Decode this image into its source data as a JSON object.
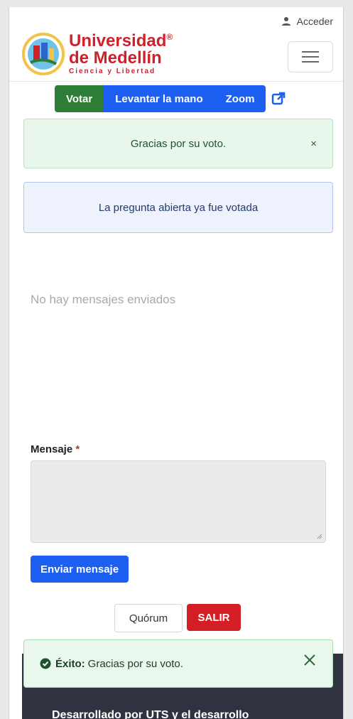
{
  "header": {
    "login_label": "Acceder",
    "logo": {
      "line1": "Universidad",
      "registered": "®",
      "line2": "de Medellín",
      "tagline": "Ciencia y Libertad"
    }
  },
  "actions": {
    "vote_label": "Votar",
    "raise_hand_label": "Levantar la mano",
    "zoom_label": "Zoom"
  },
  "alerts": {
    "success_text": "Gracias por su voto.",
    "success_close": "×",
    "info_text": "La pregunta abierta ya fue votada"
  },
  "messages": {
    "empty_text": "No hay mensajes enviados",
    "label": "Mensaje",
    "required_mark": "*",
    "send_label": "Enviar mensaje"
  },
  "controls": {
    "quorum_label": "Quórum",
    "exit_label": "SALIR"
  },
  "footer": {
    "text": "Desarrollado por UTS y el desarrollo"
  },
  "toast": {
    "title": "Éxito:",
    "message": "Gracias por su voto."
  },
  "colors": {
    "brand_red": "#d0212b",
    "vote_green": "#2e7d36",
    "primary_blue": "#1d5ff0",
    "exit_red": "#d41d25"
  }
}
